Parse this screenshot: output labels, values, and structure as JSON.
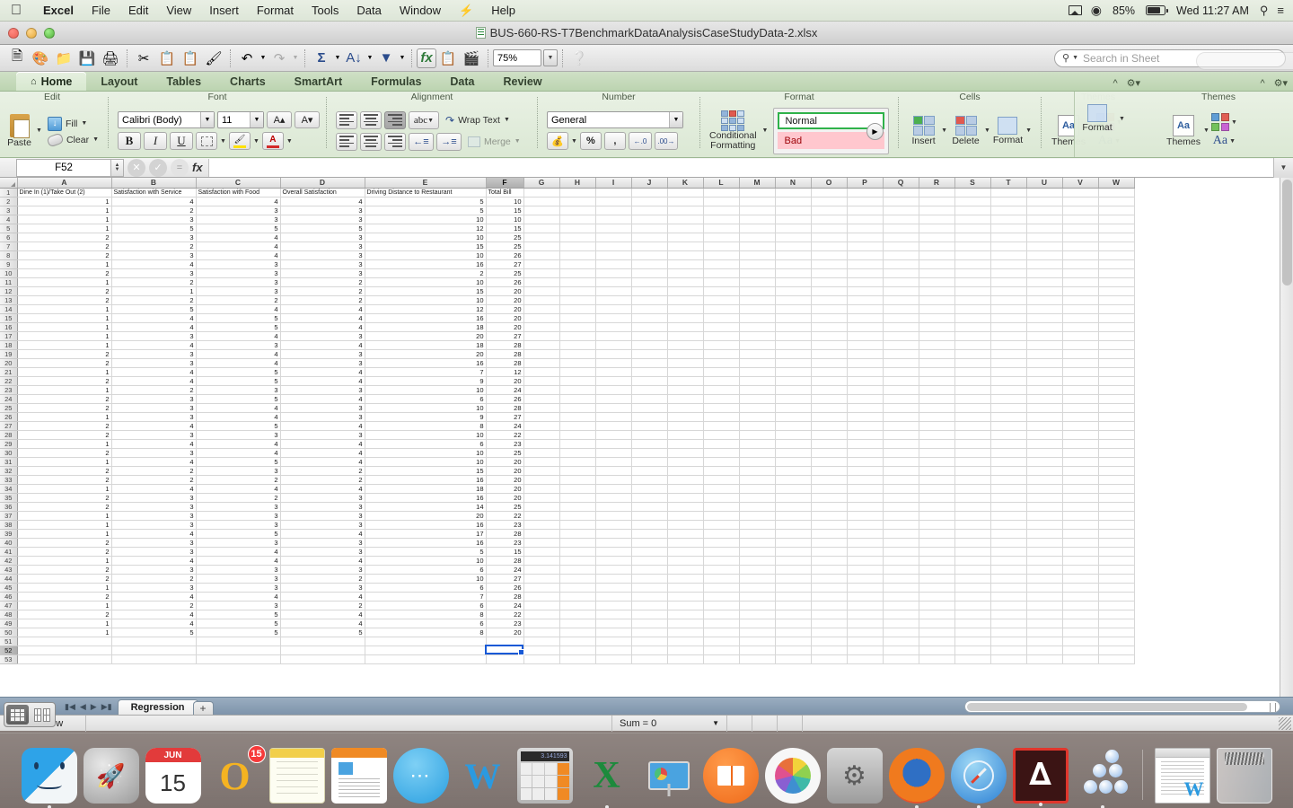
{
  "menubar": {
    "apple": "apple-logo",
    "items": [
      "Excel",
      "File",
      "Edit",
      "View",
      "Insert",
      "Format",
      "Tools",
      "Data",
      "Window",
      "Help"
    ],
    "status": {
      "battery": "85%",
      "clock": "Wed 11:27 AM"
    }
  },
  "window": {
    "title": "BUS-660-RS-T7BenchmarkDataAnalysisCaseStudyData-2.xlsx"
  },
  "toolbar": {
    "zoom": "75%",
    "search_placeholder": "Search in Sheet",
    "buttons": [
      "new-document",
      "open-template",
      "open-recent",
      "save",
      "print",
      "cut",
      "copy",
      "paste",
      "format-painter",
      "undo",
      "redo",
      "autosum",
      "sort",
      "filter",
      "formula-builder",
      "show-toolbox",
      "media-browser",
      "help"
    ]
  },
  "ribbon": {
    "tabs": [
      "Home",
      "Layout",
      "Tables",
      "Charts",
      "SmartArt",
      "Formulas",
      "Data",
      "Review"
    ],
    "active_tab": "Home",
    "groups": {
      "edit": {
        "title": "Edit",
        "paste": "Paste",
        "fill": "Fill",
        "clear": "Clear"
      },
      "font": {
        "title": "Font",
        "family": "Calibri (Body)",
        "size": "11",
        "bold": "B",
        "italic": "I",
        "underline": "U",
        "grow": "A",
        "shrink": "A"
      },
      "alignment": {
        "title": "Alignment",
        "orientation": "abc",
        "wrap_text": "Wrap Text",
        "merge": "Merge"
      },
      "number": {
        "title": "Number",
        "format": "General",
        "percent": "%",
        "comma": ",",
        "decrease_decimal": ".00",
        "increase_decimal": ".00"
      },
      "format": {
        "title": "Format",
        "conditional_formatting": "Conditional Formatting",
        "style_normal": "Normal",
        "style_bad": "Bad"
      },
      "cells": {
        "title": "Cells",
        "insert": "Insert",
        "delete": "Delete",
        "format": "Format"
      },
      "themes": {
        "title": "Themes",
        "themes": "Themes",
        "aa": "Aa"
      }
    }
  },
  "formula_bar": {
    "name_box": "F52",
    "formula": "",
    "fx": "fx"
  },
  "grid": {
    "columns": [
      "A",
      "B",
      "C",
      "D",
      "E",
      "F",
      "G",
      "H",
      "I",
      "J",
      "K",
      "L",
      "M",
      "N",
      "O",
      "P",
      "Q",
      "R",
      "S",
      "T",
      "U",
      "V",
      "W"
    ],
    "selected_column": "F",
    "selected_cell": "F52",
    "headers": [
      "Dine In (1)/Take Out (2)",
      "Satisfaction with Service",
      "Satisfaction with Food",
      "Overall Satisfaction",
      "Driving Distance to Restaurant",
      "Total Bill"
    ],
    "rows": [
      [
        1,
        4,
        4,
        4,
        5,
        10
      ],
      [
        1,
        2,
        3,
        3,
        5,
        15
      ],
      [
        1,
        3,
        3,
        3,
        10,
        10
      ],
      [
        1,
        5,
        5,
        5,
        12,
        15
      ],
      [
        2,
        3,
        4,
        3,
        10,
        25
      ],
      [
        2,
        2,
        4,
        3,
        15,
        25
      ],
      [
        2,
        3,
        4,
        3,
        10,
        26
      ],
      [
        1,
        4,
        3,
        3,
        16,
        27
      ],
      [
        2,
        3,
        3,
        3,
        2,
        25
      ],
      [
        1,
        2,
        3,
        2,
        10,
        26
      ],
      [
        2,
        1,
        3,
        2,
        15,
        20
      ],
      [
        2,
        2,
        2,
        2,
        10,
        20
      ],
      [
        1,
        5,
        4,
        4,
        12,
        20
      ],
      [
        1,
        4,
        5,
        4,
        16,
        20
      ],
      [
        1,
        4,
        5,
        4,
        18,
        20
      ],
      [
        1,
        3,
        4,
        3,
        20,
        27
      ],
      [
        1,
        4,
        3,
        4,
        18,
        28
      ],
      [
        2,
        3,
        4,
        3,
        20,
        28
      ],
      [
        2,
        3,
        4,
        3,
        16,
        28
      ],
      [
        1,
        4,
        5,
        4,
        7,
        12
      ],
      [
        2,
        4,
        5,
        4,
        9,
        20
      ],
      [
        1,
        2,
        3,
        3,
        10,
        24
      ],
      [
        2,
        3,
        5,
        4,
        6,
        26
      ],
      [
        2,
        3,
        4,
        3,
        10,
        28
      ],
      [
        1,
        3,
        4,
        3,
        9,
        27
      ],
      [
        2,
        4,
        5,
        4,
        8,
        24
      ],
      [
        2,
        3,
        3,
        3,
        10,
        22
      ],
      [
        1,
        4,
        4,
        4,
        6,
        23
      ],
      [
        2,
        3,
        4,
        4,
        10,
        25
      ],
      [
        1,
        4,
        5,
        4,
        10,
        20
      ],
      [
        2,
        2,
        3,
        2,
        15,
        20
      ],
      [
        2,
        2,
        2,
        2,
        16,
        20
      ],
      [
        1,
        4,
        4,
        4,
        18,
        20
      ],
      [
        2,
        3,
        2,
        3,
        16,
        20
      ],
      [
        2,
        3,
        3,
        3,
        14,
        25
      ],
      [
        1,
        3,
        3,
        3,
        20,
        22
      ],
      [
        1,
        3,
        3,
        3,
        16,
        23
      ],
      [
        1,
        4,
        5,
        4,
        17,
        28
      ],
      [
        2,
        3,
        3,
        3,
        16,
        23
      ],
      [
        2,
        3,
        4,
        3,
        5,
        15
      ],
      [
        1,
        4,
        4,
        4,
        10,
        28
      ],
      [
        2,
        3,
        3,
        3,
        6,
        24
      ],
      [
        2,
        2,
        3,
        2,
        10,
        27
      ],
      [
        1,
        3,
        3,
        3,
        6,
        26
      ],
      [
        2,
        4,
        4,
        4,
        7,
        28
      ],
      [
        1,
        2,
        3,
        2,
        6,
        24
      ],
      [
        2,
        4,
        5,
        4,
        8,
        22
      ],
      [
        1,
        4,
        5,
        4,
        6,
        23
      ],
      [
        1,
        5,
        5,
        5,
        8,
        20
      ]
    ],
    "first_data_row": 2,
    "last_visible_row": 53
  },
  "sheet_tabs": {
    "tabs": [
      "Regression"
    ],
    "active": "Regression",
    "add_label": "+"
  },
  "status_bar": {
    "view": "Normal View",
    "sum": "Sum = 0"
  },
  "dock": {
    "items": [
      {
        "name": "finder",
        "badge": null
      },
      {
        "name": "launchpad",
        "badge": null
      },
      {
        "name": "calendar",
        "badge": null,
        "month": "JUN",
        "day": "15"
      },
      {
        "name": "outlook",
        "badge": "15"
      },
      {
        "name": "notes",
        "badge": null
      },
      {
        "name": "pages",
        "badge": null
      },
      {
        "name": "messages",
        "badge": null
      },
      {
        "name": "word",
        "badge": null
      },
      {
        "name": "calculator",
        "badge": null,
        "display": "3.141593"
      },
      {
        "name": "excel",
        "badge": null
      },
      {
        "name": "keynote",
        "badge": null
      },
      {
        "name": "ibooks",
        "badge": null
      },
      {
        "name": "photos",
        "badge": null
      },
      {
        "name": "system-preferences",
        "badge": null
      },
      {
        "name": "firefox",
        "badge": null
      },
      {
        "name": "safari",
        "badge": null
      },
      {
        "name": "adobe-acrobat",
        "badge": null
      },
      {
        "name": "grapher",
        "badge": null
      },
      {
        "name": "word-document",
        "badge": null
      },
      {
        "name": "trash",
        "badge": null
      }
    ]
  },
  "colors": {
    "menubar": "#e3ebdd",
    "ribbon": "#dbe8d4",
    "selection": "#1759d6",
    "bad_bg": "#ffc7ce",
    "bad_fg": "#9c0006",
    "normal_border": "#2fb24a",
    "tabbar": "#8aa0b5"
  }
}
